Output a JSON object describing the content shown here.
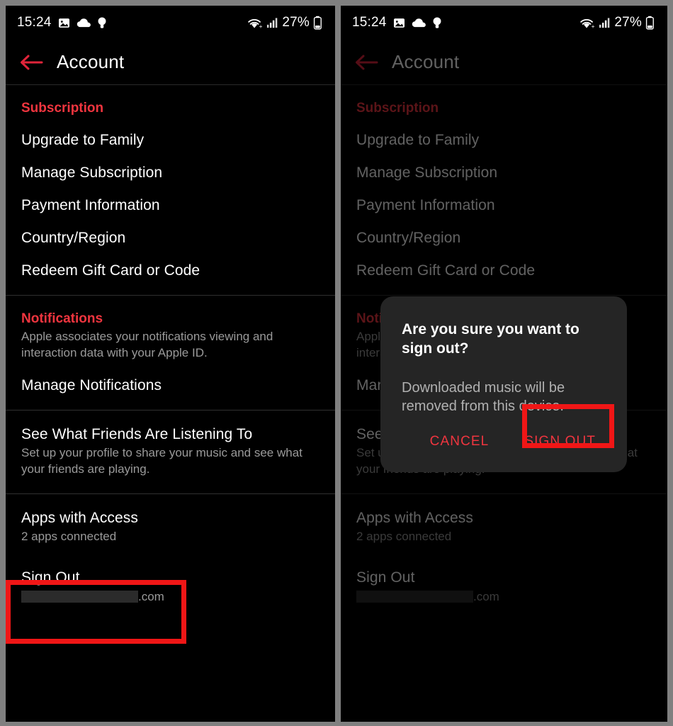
{
  "status_bar": {
    "time": "15:24",
    "battery_percent": "27%",
    "icons": [
      "photo-icon",
      "cloud-icon",
      "lightbulb-icon",
      "wifi-icon",
      "cellular-signal-icon",
      "battery-icon"
    ]
  },
  "app_bar": {
    "back_icon": "back-arrow-icon",
    "title": "Account"
  },
  "colors": {
    "accent_red": "#f0353f",
    "annotation_red": "#f01616",
    "background": "#000000",
    "dialog_background": "#252525",
    "secondary_text": "#9a9a9a"
  },
  "sections": {
    "subscription": {
      "header": "Subscription",
      "items": [
        {
          "title": "Upgrade to Family"
        },
        {
          "title": "Manage Subscription"
        },
        {
          "title": "Payment Information"
        },
        {
          "title": "Country/Region"
        },
        {
          "title": "Redeem Gift Card or Code"
        }
      ]
    },
    "notifications": {
      "header": "Notifications",
      "description": "Apple associates your notifications viewing and interaction data with your Apple ID.",
      "items": [
        {
          "title": "Manage Notifications"
        }
      ]
    },
    "friends": {
      "title": "See What Friends Are Listening To",
      "subtitle": "Set up your profile to share your music and see what your friends are playing."
    },
    "apps_access": {
      "title": "Apps with Access",
      "subtitle": "2 apps connected"
    },
    "sign_out": {
      "title": "Sign Out",
      "account_email_suffix": ".com"
    }
  },
  "dialog": {
    "title": "Are you sure you want to sign out?",
    "body": "Downloaded music will be removed from this device.",
    "cancel_label": "CANCEL",
    "confirm_label": "SIGN OUT"
  }
}
